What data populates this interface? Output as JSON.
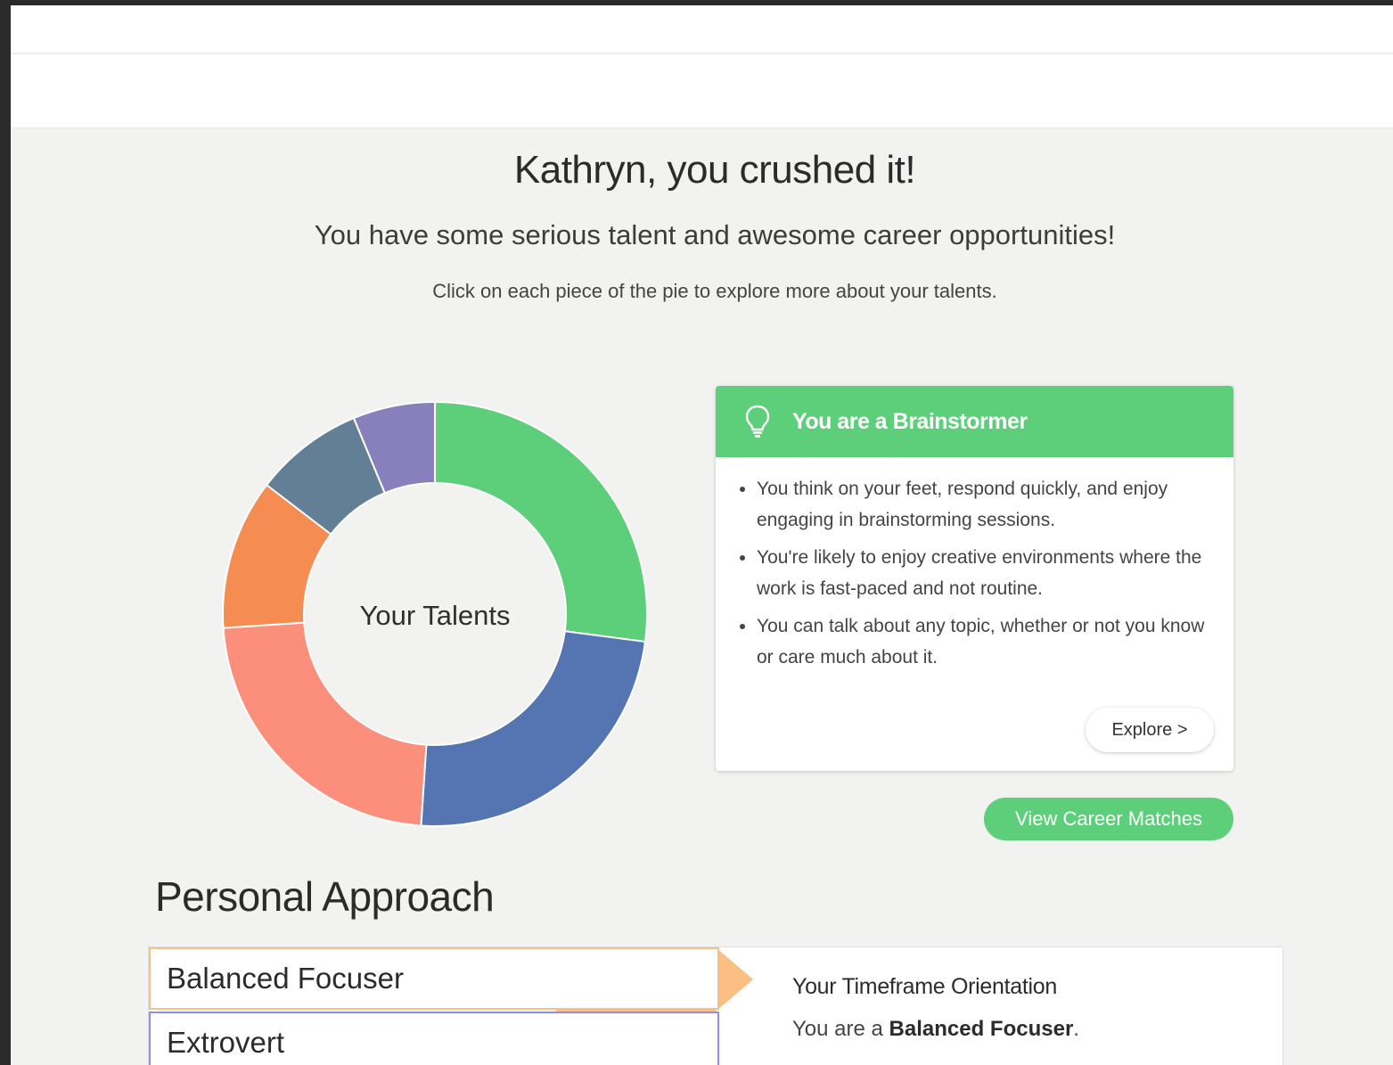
{
  "header": {
    "name": "Kathryn,",
    "headline_rest": " you crushed it!",
    "subtitle": "You have some serious talent and awesome career opportunities!",
    "instructions": "Click on each piece of the pie to explore more about your talents."
  },
  "chart_data": {
    "type": "pie",
    "center_label": "Your Talents",
    "values": [
      26,
      23,
      22,
      11,
      8,
      6
    ],
    "colors": [
      "#5dcf7a",
      "#5575b2",
      "#fc8f7c",
      "#f58c52",
      "#627f96",
      "#8780bd"
    ]
  },
  "talent_card": {
    "title": "You are a Brainstormer",
    "icon": "lightbulb-icon",
    "bullets": [
      "You think on your feet, respond quickly, and enjoy engaging in brainstorming sessions.",
      "You're likely to enjoy creative environments where the work is fast-paced and not routine.",
      "You can talk about any topic, whether or not you know or care much about it."
    ],
    "explore_label": "Explore >"
  },
  "career_button_label": "View Career Matches",
  "personal_approach": {
    "title": "Personal Approach",
    "rows": [
      {
        "label": "Balanced Focuser",
        "color": "#fbbf84"
      },
      {
        "label": "Extrovert",
        "color": "#8389f4"
      }
    ],
    "detail_title": "Your Timeframe Orientation",
    "detail_prefix": "You are a ",
    "detail_value": "Balanced Focuser",
    "detail_suffix": "."
  }
}
